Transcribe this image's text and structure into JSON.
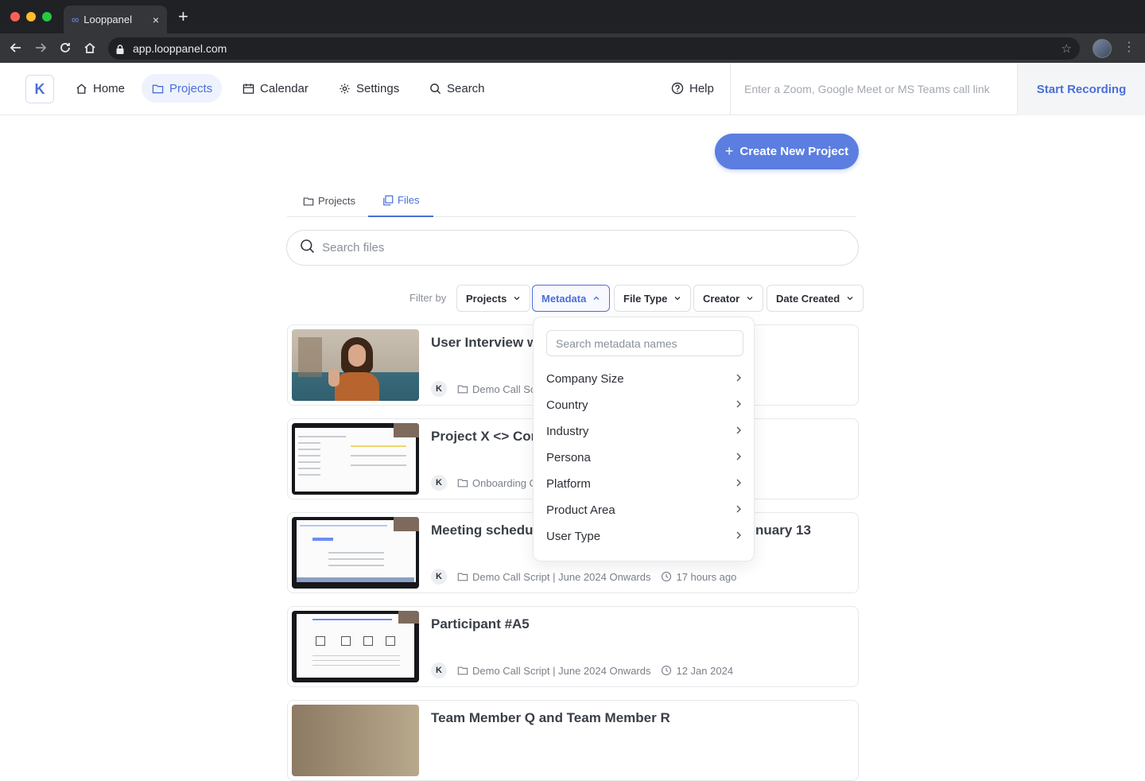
{
  "browser": {
    "tab_title": "Looppanel",
    "tab_favicon": "∞",
    "tab_close": "×",
    "new_tab": "+",
    "url": "app.looppanel.com"
  },
  "header": {
    "logo": "K",
    "nav": [
      {
        "label": "Home",
        "icon": "home-icon"
      },
      {
        "label": "Projects",
        "icon": "folder-icon",
        "active": true
      },
      {
        "label": "Calendar",
        "icon": "calendar-icon"
      },
      {
        "label": "Settings",
        "icon": "gear-icon"
      },
      {
        "label": "Search",
        "icon": "search-icon"
      }
    ],
    "help_label": "Help",
    "call_link_placeholder": "Enter a Zoom, Google Meet or MS Teams call link",
    "start_recording_label": "Start Recording"
  },
  "main": {
    "create_button_label": "Create New Project",
    "tabs": [
      {
        "label": "Projects",
        "active": false
      },
      {
        "label": "Files",
        "active": true
      }
    ],
    "search_placeholder": "Search files",
    "filter_label": "Filter by",
    "filters": [
      {
        "label": "Projects",
        "open": false
      },
      {
        "label": "Metadata",
        "open": true
      },
      {
        "label": "File Type",
        "open": false
      },
      {
        "label": "Creator",
        "open": false
      },
      {
        "label": "Date Created",
        "open": false
      }
    ]
  },
  "files": [
    {
      "title_visible": "User Interview w",
      "title_right": "",
      "avatar": "K",
      "project": "Demo Call Sc",
      "time": ""
    },
    {
      "title_visible": "Project X <> Con",
      "title_right": "",
      "avatar": "K",
      "project": "Onboarding C",
      "time": ""
    },
    {
      "title_visible": "Meeting schedul",
      "title_right": "nuary 13",
      "avatar": "K",
      "project": "Demo Call Script | June 2024 Onwards",
      "time": "17 hours ago"
    },
    {
      "title_visible": "Participant #A5",
      "title_right": "",
      "avatar": "K",
      "project": "Demo Call Script | June 2024 Onwards",
      "time": "12 Jan 2024"
    },
    {
      "title_visible": "Team Member Q and Team Member R",
      "title_right": "",
      "avatar": "",
      "project": "",
      "time": ""
    }
  ],
  "metadata_dropdown": {
    "search_placeholder": "Search metadata names",
    "items": [
      "Company Size",
      "Country",
      "Industry",
      "Persona",
      "Platform",
      "Product Area",
      "User Type"
    ]
  },
  "colors": {
    "accent": "#4a6fd8",
    "primary_button": "#5b7ee0",
    "chrome_dark": "#202124"
  }
}
